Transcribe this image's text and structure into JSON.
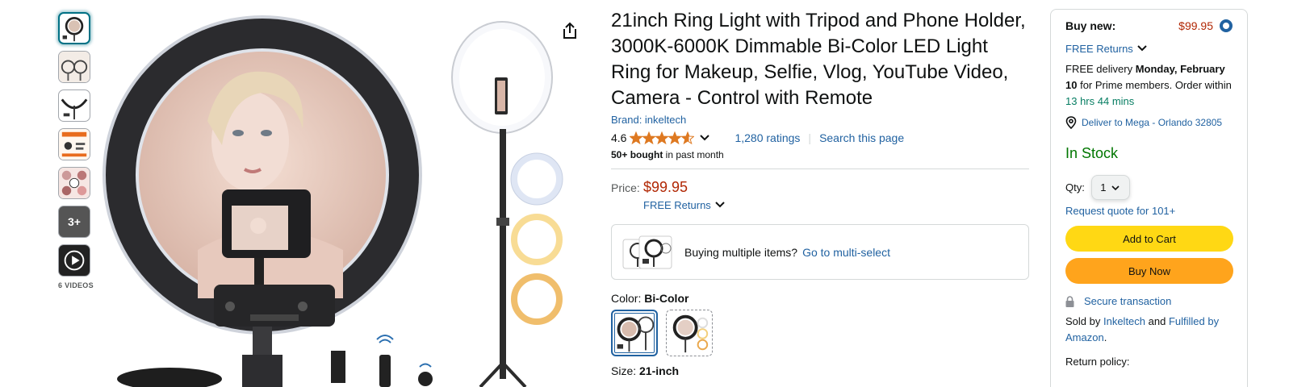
{
  "thumbnails": {
    "more_label": "3+",
    "videos_caption": "6 VIDEOS"
  },
  "product": {
    "title": "21inch Ring Light with Tripod and Phone Holder, 3000K-6000K Dimmable Bi-Color LED Light Ring for Makeup, Selfie, Vlog, YouTube Video, Camera - Control with Remote",
    "brand": "Brand: inkeltech",
    "rating": "4.6",
    "stars_value": 4.6,
    "ratings_count": "1,280 ratings",
    "separator": "|",
    "search_page": "Search this page",
    "bought_bold": "50+ bought",
    "bought_rest": " in past month",
    "price_label": "Price:",
    "price": "$99.95",
    "free_returns": "FREE Returns",
    "multi_text": "Buying multiple items?",
    "multi_link": "Go to multi-select",
    "color_label": "Color: ",
    "color_value": "Bi-Color",
    "size_label": "Size: ",
    "size_value": "21-inch"
  },
  "buybox": {
    "buy_new": "Buy new:",
    "price": "$99.95",
    "free_returns": "FREE Returns",
    "delivery_prefix": "FREE delivery ",
    "delivery_date": "Monday, February 10",
    "delivery_mid": " for Prime members. Order within ",
    "countdown": "13 hrs 44 mins",
    "deliver_to": "Deliver to Mega - Orlando 32805",
    "in_stock": "In Stock",
    "qty_label": "Qty:",
    "qty_value": "1",
    "request_quote": "Request quote for 101+",
    "add_to_cart": "Add to Cart",
    "buy_now": "Buy Now",
    "secure": "Secure transaction",
    "sold_by_prefix": "Sold by ",
    "seller": "Inkeltech",
    "sold_by_and": " and ",
    "fulfilled": "Fulfilled by Amazon",
    "sold_by_end": ".",
    "return_policy": "Return policy:"
  },
  "colors": {
    "price_red": "#b12704",
    "link_blue": "#2162a1",
    "stock_green": "#007600",
    "cart_yellow": "#ffd814",
    "buy_orange": "#ffa41c",
    "star_orange": "#de7921"
  }
}
